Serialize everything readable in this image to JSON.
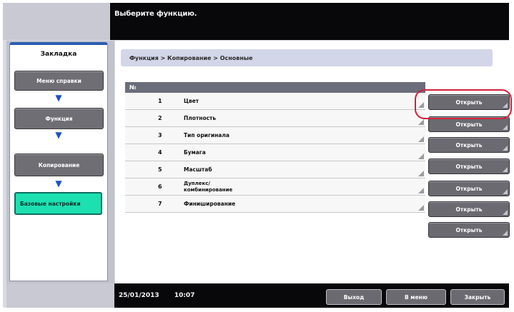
{
  "header": {
    "message": "Выберите функцию."
  },
  "sidebar": {
    "tab_title": "Закладка",
    "items": [
      {
        "label": "Меню справки"
      },
      {
        "label": "Функция"
      },
      {
        "label": "Копирование"
      },
      {
        "label": "Базовые настройки"
      }
    ]
  },
  "breadcrumb": {
    "text": "Функция > Копирование > Основные"
  },
  "table": {
    "header": "№",
    "rows": [
      {
        "num": "1",
        "label": "Цвет",
        "button": "Открыть"
      },
      {
        "num": "2",
        "label": "Плотность",
        "button": "Открыть"
      },
      {
        "num": "3",
        "label": "Тип оригинала",
        "button": "Открыть"
      },
      {
        "num": "4",
        "label": "Бумага",
        "button": "Открыть"
      },
      {
        "num": "5",
        "label": "Масштаб",
        "button": "Открыть"
      },
      {
        "num": "6",
        "label": "Дуплекс/ комбинирование",
        "button": "Открыть"
      },
      {
        "num": "7",
        "label": "Финиширование",
        "button": "Открыть"
      }
    ]
  },
  "footer": {
    "date": "25/01/2013",
    "time": "10:07",
    "exit_label": "Выход",
    "to_menu_label": "В меню",
    "close_label": "Закрыть"
  },
  "colors": {
    "accent": "#1ce0b0",
    "highlight": "#d4203a",
    "arrow": "#1e4fc8"
  }
}
